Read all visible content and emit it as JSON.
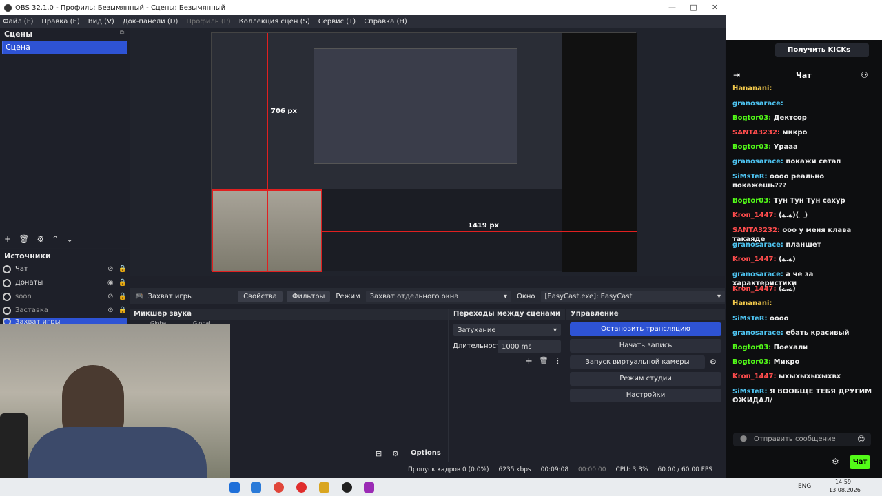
{
  "window": {
    "title": "OBS 32.1.0 - Профиль: Безымянный - Сцены: Безымянный",
    "min": "—",
    "max": "□",
    "close": "✕"
  },
  "menu": [
    "Файл (F)",
    "Правка (E)",
    "Вид (V)",
    "Док-панели (D)",
    "Профиль (P)",
    "Коллекция сцен (S)",
    "Сервис (T)",
    "Справка (H)"
  ],
  "scenes": {
    "title": "Сцены",
    "items": [
      "Сцена"
    ]
  },
  "sources": {
    "title": "Источники",
    "items": [
      "Чат",
      "Донаты",
      "soon",
      "Заставка",
      "Захват игры"
    ]
  },
  "preview": {
    "label_h": "706 px",
    "label_w": "1419 px"
  },
  "context": {
    "source_name": "Захват игры",
    "properties": "Свойства",
    "filters": "Фильтры",
    "mode_label": "Режим",
    "mode_value": "Захват отдельного окна",
    "window_label": "Окно",
    "window_value": "[EasyCast.exe]: EasyCast"
  },
  "mixer": {
    "title": "Микшер звука",
    "labels": [
      "Global",
      "Global"
    ],
    "options": "Options"
  },
  "transitions": {
    "title": "Переходы между сценами",
    "type": "Затухание",
    "duration_label": "Длительность",
    "duration_value": "1000 ms"
  },
  "controls": {
    "title": "Управление",
    "buttons": [
      "Остановить трансляцию",
      "Начать запись",
      "Запуск виртуальной камеры",
      "Режим студии",
      "Настройки"
    ]
  },
  "status": {
    "dropped": "Пропуск кадров 0 (0.0%)",
    "bitrate": "6235 kbps",
    "stream_time": "00:09:08",
    "rec_time": "00:00:00",
    "cpu": "CPU: 3.3%",
    "fps": "60.00 / 60.00 FPS"
  },
  "chat": {
    "kicks_button": "Получить KICKs",
    "title": "Чат",
    "messages": [
      {
        "user": "Hananani:",
        "text": "",
        "color": "#f2c94c"
      },
      {
        "user": "granosarace:",
        "text": "",
        "color": "#4ec3f0"
      },
      {
        "user": "Bogtor03:",
        "text": "Дектсор",
        "color": "#53fc18"
      },
      {
        "user": "SANTA3232:",
        "text": "микро",
        "color": "#ff4d4d"
      },
      {
        "user": "Bogtor03:",
        "text": "Урааа",
        "color": "#53fc18"
      },
      {
        "user": "granosarace:",
        "text": "покажи сетап",
        "color": "#4ec3f0"
      },
      {
        "user": "SiMsTeR:",
        "text": "оооо реально покажешь???",
        "color": "#4ec3f0"
      },
      {
        "user": "Bogtor03:",
        "text": "Тун Тун Тун сахур",
        "color": "#53fc18"
      },
      {
        "user": "Kron_1447:",
        "text": "(ے.ے)(‿)",
        "color": "#ff4d4d"
      },
      {
        "user": "SANTA3232:",
        "text": "ооо у меня клава такаяде",
        "color": "#ff4d4d"
      },
      {
        "user": "granosarace:",
        "text": "планшет",
        "color": "#4ec3f0"
      },
      {
        "user": "Kron_1447:",
        "text": "(ے.ے)",
        "color": "#ff4d4d"
      },
      {
        "user": "granosarace:",
        "text": "а че за характеристики",
        "color": "#4ec3f0"
      },
      {
        "user": "Kron_1447:",
        "text": "(ے.ے)",
        "color": "#ff4d4d"
      },
      {
        "user": "Hananani:",
        "text": "",
        "color": "#f2c94c"
      },
      {
        "user": "SiMsTeR:",
        "text": "оооо",
        "color": "#4ec3f0"
      },
      {
        "user": "granosarace:",
        "text": "ебать красивый",
        "color": "#4ec3f0"
      },
      {
        "user": "Bogtor03:",
        "text": "Поехали",
        "color": "#53fc18"
      },
      {
        "user": "Bogtor03:",
        "text": "Микро",
        "color": "#53fc18"
      },
      {
        "user": "Kron_1447:",
        "text": "ыхыхыхыхыхвх",
        "color": "#ff4d4d"
      },
      {
        "user": "SiMsTeR:",
        "text": "Я ВООБЩЕ ТЕБЯ ДРУГИМ ОЖИДАЛ/",
        "color": "#4ec3f0"
      }
    ],
    "input_placeholder": "Отправить сообщение",
    "send": "Чат"
  },
  "taskbar": {
    "lang": "ENG",
    "time": "14:59",
    "date": "13.08.2026"
  },
  "colors": {
    "accent": "#2e53d4",
    "kick_green": "#53fc18"
  }
}
